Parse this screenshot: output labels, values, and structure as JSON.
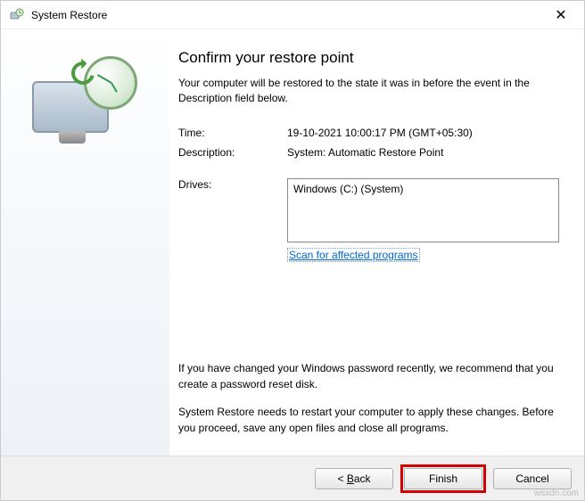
{
  "titlebar": {
    "title": "System Restore"
  },
  "heading": "Confirm your restore point",
  "subtitle": "Your computer will be restored to the state it was in before the event in the Description field below.",
  "fields": {
    "time_label": "Time:",
    "time_value": "19-10-2021 10:00:17 PM (GMT+05:30)",
    "desc_label": "Description:",
    "desc_value": "System: Automatic Restore Point",
    "drives_label": "Drives:",
    "drives_value": "Windows (C:) (System)"
  },
  "scan_link": "Scan for affected programs",
  "note_password": "If you have changed your Windows password recently, we recommend that you create a password reset disk.",
  "note_restart": "System Restore needs to restart your computer to apply these changes. Before you proceed, save any open files and close all programs.",
  "buttons": {
    "back": "< Back",
    "finish": "Finish",
    "cancel": "Cancel"
  },
  "watermark": "wsxdn.com"
}
